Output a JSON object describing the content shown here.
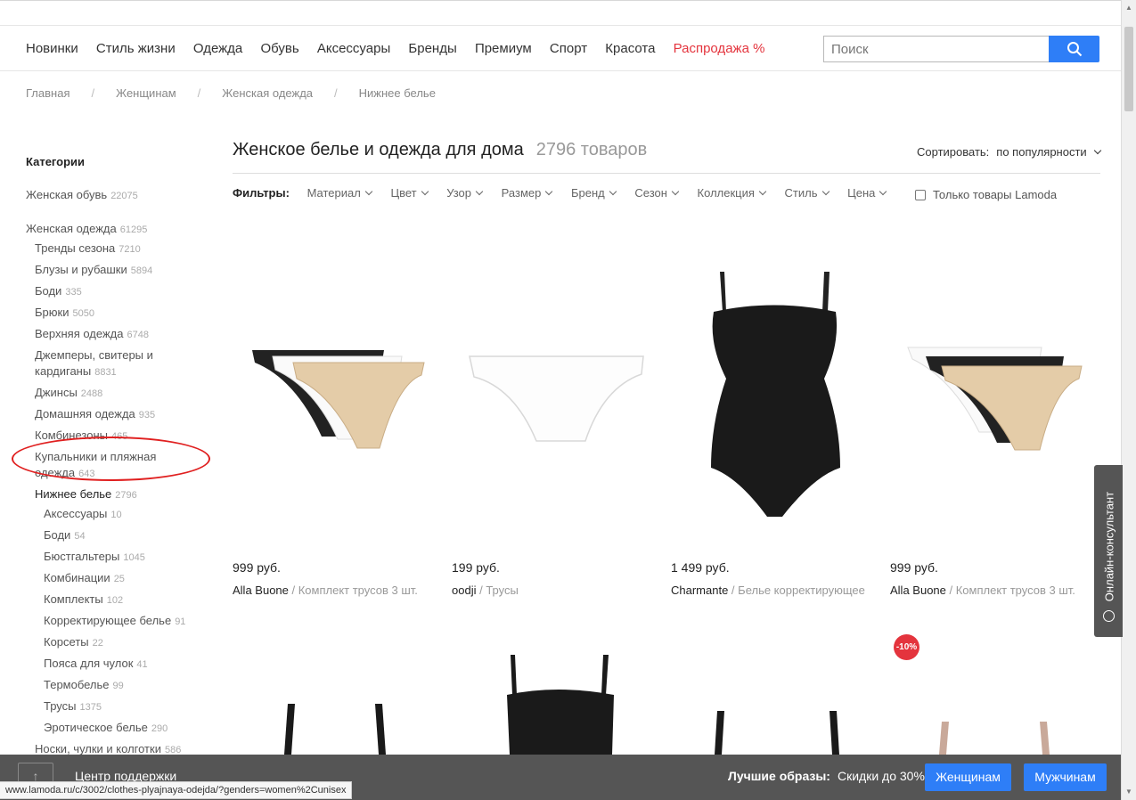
{
  "nav": {
    "items": [
      "Новинки",
      "Стиль жизни",
      "Одежда",
      "Обувь",
      "Аксессуары",
      "Бренды",
      "Премиум",
      "Спорт",
      "Красота"
    ],
    "sale": "Распродажа %",
    "search_placeholder": "Поиск"
  },
  "breadcrumbs": [
    "Главная",
    "Женщинам",
    "Женская одежда",
    "Нижнее белье"
  ],
  "breadcrumb_separator": "/",
  "sidebar": {
    "title": "Категории",
    "items": [
      {
        "label": "Женская обувь",
        "count": "22075"
      },
      {
        "label": "Женская одежда",
        "count": "61295"
      },
      {
        "label": "Тренды сезона",
        "count": "7210"
      },
      {
        "label": "Блузы и рубашки",
        "count": "5894"
      },
      {
        "label": "Боди",
        "count": "335"
      },
      {
        "label": "Брюки",
        "count": "5050"
      },
      {
        "label": "Верхняя одежда",
        "count": "6748"
      },
      {
        "label": "Джемперы, свитеры и",
        "count": ""
      },
      {
        "label": "кардиганы",
        "count": "8831"
      },
      {
        "label": "Джинсы",
        "count": "2488"
      },
      {
        "label": "Домашняя одежда",
        "count": "935"
      },
      {
        "label": "Комбинезоны",
        "count": "465"
      },
      {
        "label": "Купальники и пляжная",
        "count": ""
      },
      {
        "label": "одежда",
        "count": "643"
      },
      {
        "label": "Нижнее белье",
        "count": "2796"
      },
      {
        "label": "Аксессуары",
        "count": "10"
      },
      {
        "label": "Боди",
        "count": "54"
      },
      {
        "label": "Бюстгальтеры",
        "count": "1045"
      },
      {
        "label": "Комбинации",
        "count": "25"
      },
      {
        "label": "Комплекты",
        "count": "102"
      },
      {
        "label": "Корректирующее белье",
        "count": "91"
      },
      {
        "label": "Корсеты",
        "count": "22"
      },
      {
        "label": "Пояса для чулок",
        "count": "41"
      },
      {
        "label": "Термобелье",
        "count": "99"
      },
      {
        "label": "Трусы",
        "count": "1375"
      },
      {
        "label": "Эротическое белье",
        "count": "290"
      },
      {
        "label": "Носки, чулки и колготки",
        "count": "586"
      }
    ]
  },
  "heading": {
    "title": "Женское белье и одежда для дома",
    "count": "2796 товаров"
  },
  "sort": {
    "label": "Сортировать:",
    "value": "по популярности"
  },
  "filters": {
    "label": "Фильтры:",
    "items": [
      "Материал",
      "Цвет",
      "Узор",
      "Размер",
      "Бренд",
      "Сезон",
      "Коллекция",
      "Стиль",
      "Цена"
    ],
    "lamoda_only": "Только товары Lamoda"
  },
  "products": [
    {
      "price": "999 руб.",
      "brand": "Alla Buone",
      "sep": " / ",
      "type": "Комплект трусов 3 шт."
    },
    {
      "price": "199 руб.",
      "brand": "oodji",
      "sep": " / ",
      "type": "Трусы"
    },
    {
      "price": "1 499 руб.",
      "brand": "Charmante",
      "sep": " / ",
      "type": "Белье корректирующее"
    },
    {
      "price": "999 руб.",
      "brand": "Alla Buone",
      "sep": " / ",
      "type": "Комплект трусов 3 шт."
    }
  ],
  "discount_badge": "-10%",
  "chat_label": "Онлайн-консультант",
  "bottom": {
    "support": "Центр поддержки",
    "best_label": "Лучшие образы:",
    "best_text": "Скидки до 30%",
    "women_button": "Женщинам",
    "men_button": "Мужчинам"
  },
  "status_url": "www.lamoda.ru/c/3002/clothes-plyajnaya-odejda/?genders=women%2Cunisex",
  "colors": {
    "accent": "#2e7ef7",
    "sale": "#e4343d",
    "bottom_bar": "#555555",
    "annotation": "#e02020"
  }
}
